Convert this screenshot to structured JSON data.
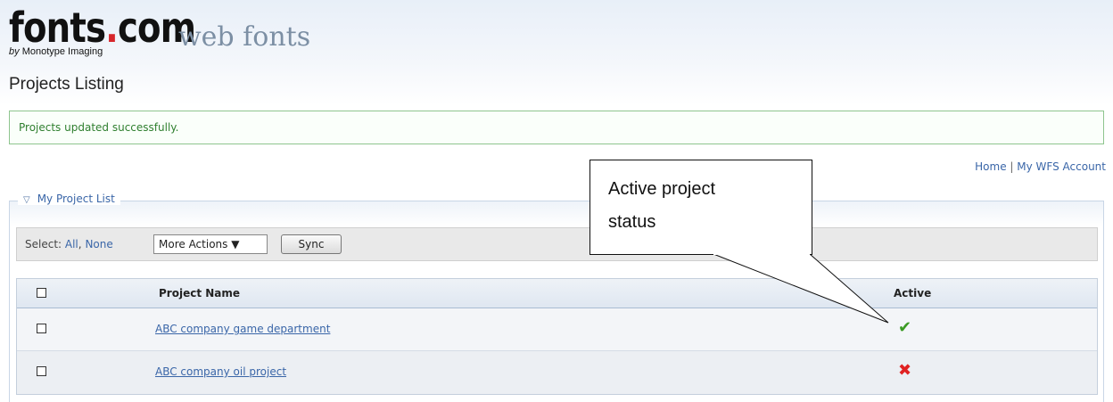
{
  "brand": {
    "logo_main_a": "fonts",
    "logo_dot": ".",
    "logo_main_b": "com",
    "logo_sub": "web fonts",
    "logo_by": "by",
    "logo_company": "Monotype Imaging"
  },
  "page": {
    "title": "Projects Listing"
  },
  "notice": {
    "message": "Projects updated successfully."
  },
  "toplinks": {
    "home": "Home",
    "separator": "|",
    "account": "My WFS Account"
  },
  "project_list": {
    "legend": "My Project List"
  },
  "toolbar": {
    "select_label": "Select:",
    "select_all": "All",
    "select_sep": ",",
    "select_none": "None",
    "more_actions": "More Actions ▼",
    "sync": "Sync"
  },
  "table": {
    "headers": {
      "name": "Project Name",
      "active": "Active"
    },
    "rows": [
      {
        "name": "ABC company game department",
        "active": "✔",
        "active_state": true
      },
      {
        "name": "ABC company oil project",
        "active": "✖",
        "active_state": false
      }
    ]
  },
  "callout": {
    "line1": "Active project",
    "line2": "status"
  },
  "colors": {
    "link": "#3a66a8",
    "success_text": "#2f7f2f",
    "success_border": "#8ec58e",
    "active_check": "#3a9a23",
    "inactive_x": "#e02222",
    "logo_dot": "#d7262b"
  },
  "icons": {
    "collapse": "triangle-down-icon",
    "active": "checkmark-icon",
    "inactive": "x-icon"
  }
}
